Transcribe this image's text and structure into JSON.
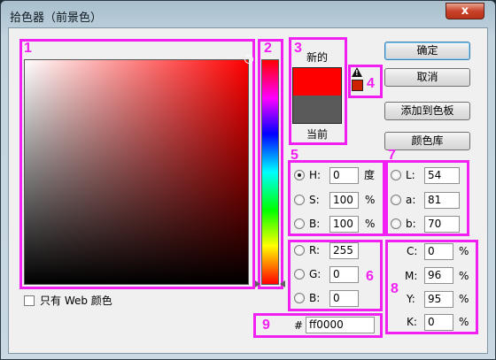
{
  "window": {
    "title": "拾色器（前景色）",
    "close_glyph": "x"
  },
  "annotations": {
    "n1": "1",
    "n2": "2",
    "n3": "3",
    "n4": "4",
    "n5": "5",
    "n6": "6",
    "n7": "7",
    "n8": "8",
    "n9": "9"
  },
  "swatch": {
    "new_label": "新的",
    "current_label": "当前",
    "new_color": "#ff0000",
    "current_color": "#5a5a5a"
  },
  "gamut_warning": {
    "glyph": "!",
    "swatch_color": "#cc2200"
  },
  "buttons": {
    "ok": "确定",
    "cancel": "取消",
    "add_to_swatches": "添加到色板",
    "color_libraries": "颜色库"
  },
  "hsb": {
    "h": {
      "label": "H:",
      "value": "0",
      "unit": "度",
      "selected": true
    },
    "s": {
      "label": "S:",
      "value": "100",
      "unit": "%"
    },
    "b": {
      "label": "B:",
      "value": "100",
      "unit": "%"
    }
  },
  "rgb": {
    "r": {
      "label": "R:",
      "value": "255"
    },
    "g": {
      "label": "G:",
      "value": "0"
    },
    "b": {
      "label": "B:",
      "value": "0"
    }
  },
  "lab": {
    "l": {
      "label": "L:",
      "value": "54"
    },
    "a": {
      "label": "a:",
      "value": "81"
    },
    "b": {
      "label": "b:",
      "value": "70"
    }
  },
  "cmyk": {
    "c": {
      "label": "C:",
      "value": "0",
      "unit": "%"
    },
    "m": {
      "label": "M:",
      "value": "96",
      "unit": "%"
    },
    "y": {
      "label": "Y:",
      "value": "95",
      "unit": "%"
    },
    "k": {
      "label": "K:",
      "value": "0",
      "unit": "%"
    }
  },
  "hex": {
    "prefix": "#",
    "value": "ff0000"
  },
  "web_only": {
    "label": "只有 Web 颜色",
    "checked": false
  },
  "colors": {
    "annotation": "#f21ff2",
    "selected_hue": "#ff0000"
  }
}
